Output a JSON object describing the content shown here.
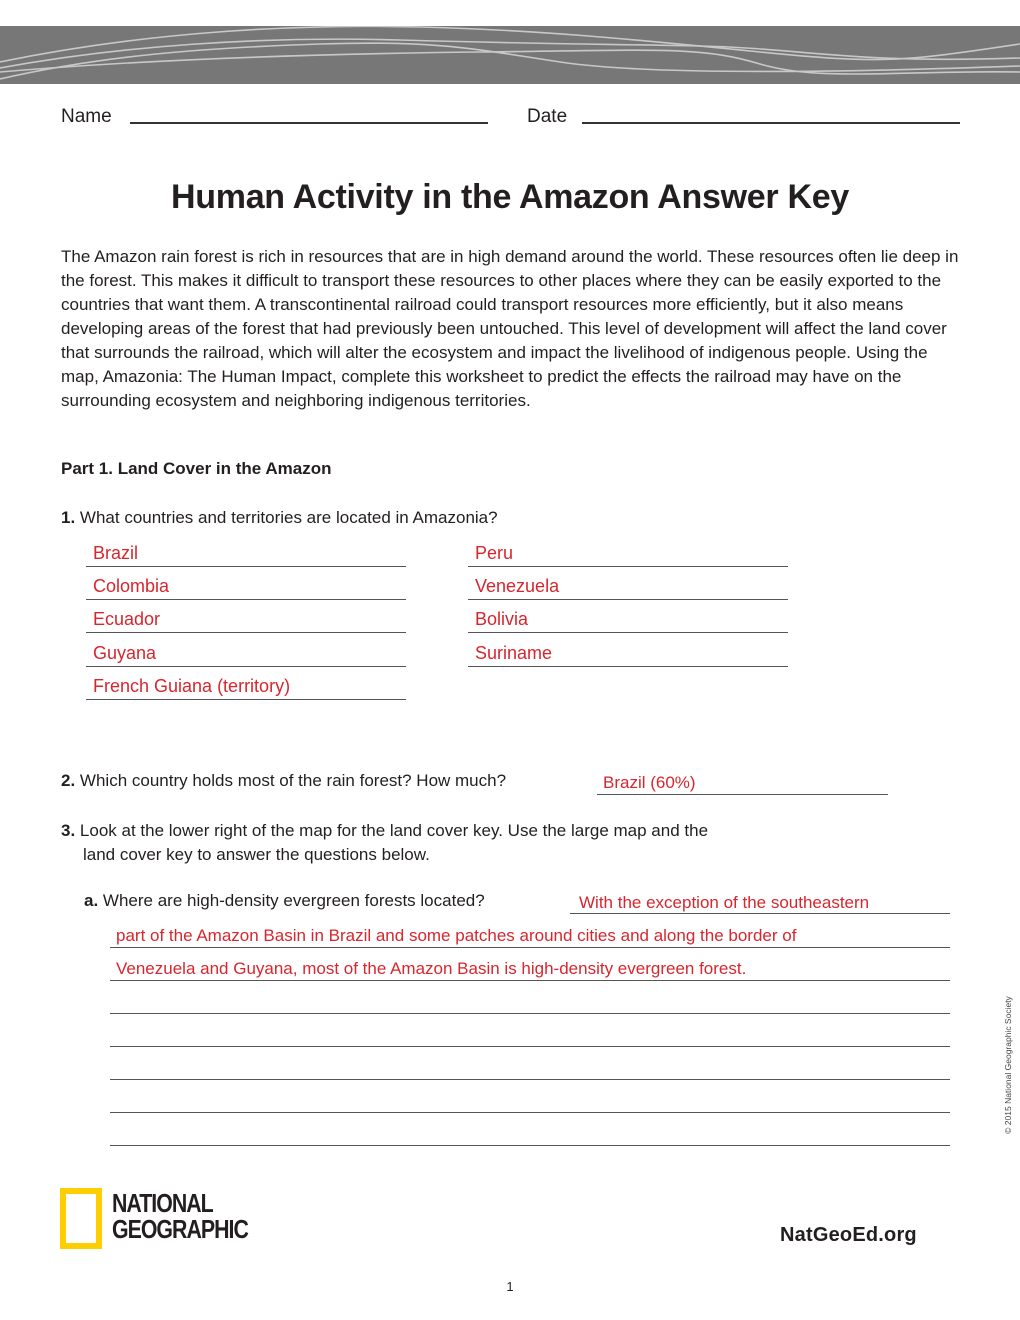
{
  "header": {
    "name_label": "Name",
    "date_label": "Date"
  },
  "title": "Human Activity in the Amazon Answer Key",
  "intro": "The Amazon rain forest is rich in resources that are in high demand around the world. These resources often lie deep in the forest. This makes it difficult to transport these resources to other places where they can be easily exported to the countries that want them. A transcontinental railroad could transport resources more efficiently, but it also means developing areas of the forest that had previously been untouched. This level of development will affect the land cover that surrounds the railroad, which will alter the ecosystem and impact the livelihood of indigenous people. Using the map, Amazonia: The Human Impact, complete this worksheet to predict the effects the railroad may have on the surrounding ecosystem and neighboring indigenous territories.",
  "part1": {
    "heading": "Part 1. Land Cover in the Amazon",
    "q1": {
      "number": "1.",
      "text": "What countries and territories are located in Amazonia?",
      "answers_left": [
        "Brazil",
        "Colombia",
        "Ecuador",
        "Guyana",
        "French Guiana (territory)"
      ],
      "answers_right": [
        "Peru",
        "Venezuela",
        "Bolivia",
        "Suriname"
      ]
    },
    "q2": {
      "number": "2.",
      "text": "Which country holds most of the rain forest? How much?",
      "answer": "Brazil (60%)"
    },
    "q3": {
      "number": "3.",
      "text_line1": "Look at the lower right of the map for the land cover key. Use the large map and the",
      "text_line2": "land cover key to answer the questions below.",
      "a": {
        "letter": "a.",
        "text": "Where are high-density evergreen forests located?",
        "answer_lines": [
          "With the exception of the southeastern",
          "part of the Amazon Basin in Brazil and some patches around cities and along the border of",
          "Venezuela and Guyana, most of the Amazon Basin is high-density evergreen forest."
        ]
      }
    }
  },
  "footer": {
    "copyright": "© 2015 National Geographic Society",
    "logo_line1": "NATIONAL",
    "logo_line2": "GEOGRAPHIC",
    "site": "NatGeoEd.org",
    "page_number": "1"
  },
  "colors": {
    "answer_red": "#d7262e",
    "band_gray": "#777777",
    "logo_yellow": "#ffce00"
  }
}
